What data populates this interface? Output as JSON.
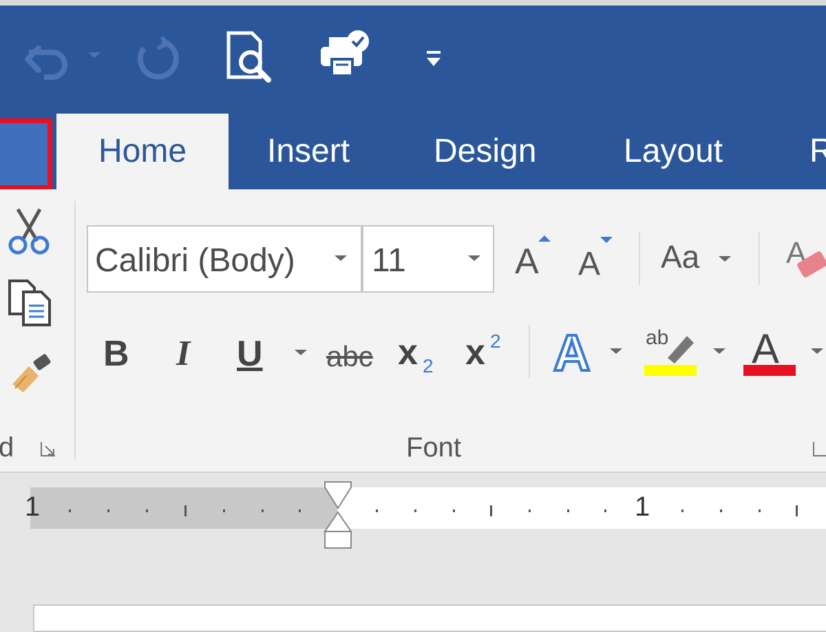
{
  "quick_access": {
    "items": [
      {
        "icon": "undo-icon",
        "enabled": false
      },
      {
        "icon": "redo-icon",
        "enabled": false
      },
      {
        "icon": "print-preview-icon",
        "enabled": true
      },
      {
        "icon": "quick-print-icon",
        "enabled": true
      },
      {
        "icon": "customize-toolbar-icon",
        "enabled": true
      }
    ]
  },
  "tabs": [
    "Home",
    "Insert",
    "Design",
    "Layout",
    "R"
  ],
  "active_tab": "Home",
  "clipboard": {
    "group_label": "d",
    "icons": [
      "cut-icon",
      "copy-icon",
      "format-painter-icon"
    ]
  },
  "font": {
    "group_label": "Font",
    "font_name": "Calibri (Body)",
    "font_size": "11",
    "change_case_label": "Aa",
    "grow_label": "A",
    "shrink_label": "A",
    "bold": "B",
    "italic": "I",
    "underline": "U",
    "strikethrough": "abc",
    "subscript_base": "x",
    "subscript_digit": "2",
    "superscript_base": "x",
    "superscript_digit": "2",
    "text_effects": "A",
    "highlight_label": "ab",
    "font_color_label": "A"
  },
  "colors": {
    "accent": "#2b579a",
    "file_tab_outline": "#e81123",
    "highlight": "#ffff00",
    "font_color": "#e81123"
  },
  "ruler": {
    "labels": [
      "1",
      "1"
    ]
  }
}
